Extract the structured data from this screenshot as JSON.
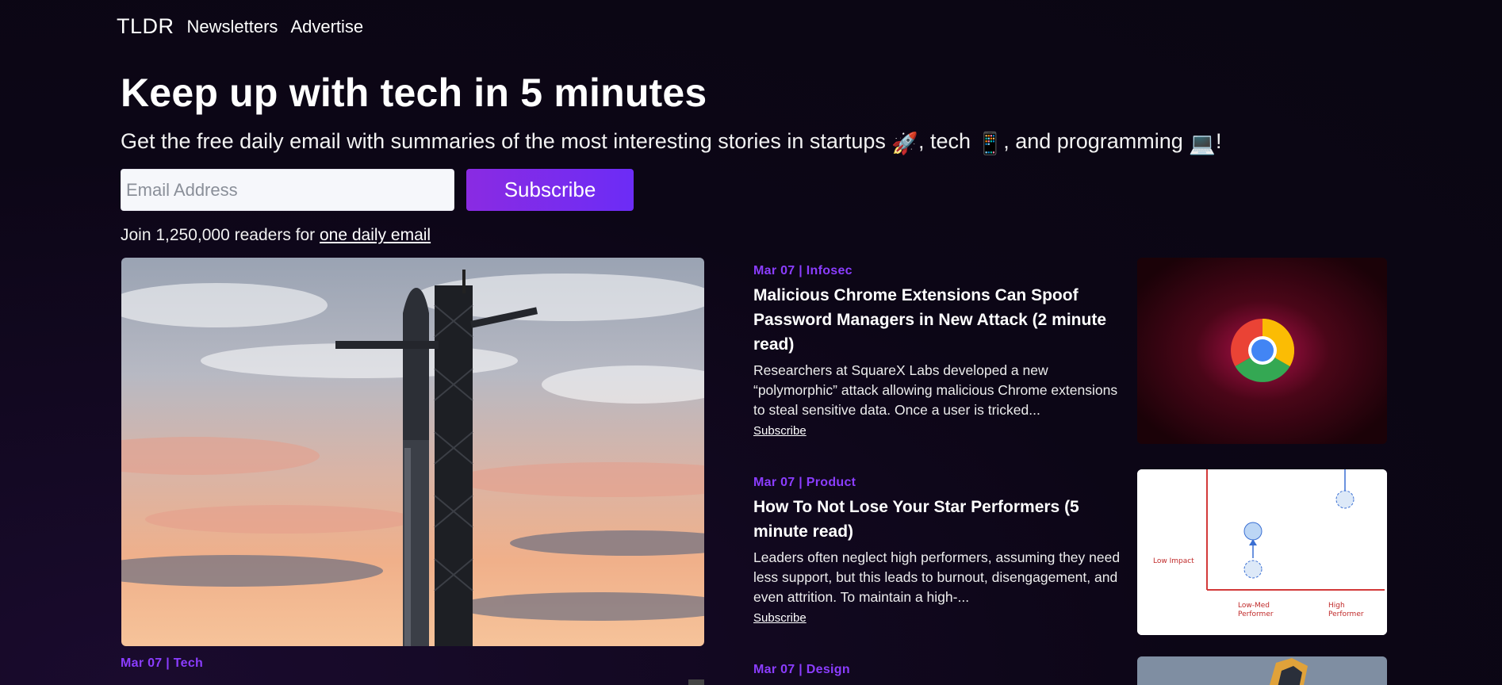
{
  "nav": {
    "brand": "TLDR",
    "links": [
      "Newsletters",
      "Advertise"
    ]
  },
  "hero": {
    "title": "Keep up with tech in 5 minutes",
    "subtitle_parts": [
      "Get the free daily email with summaries of the most interesting stories in startups ",
      "🚀",
      ", tech ",
      "📱",
      ", and programming ",
      "💻",
      "!"
    ],
    "email_placeholder": "Email Address",
    "subscribe_label": "Subscribe",
    "join_prefix": "Join 1,250,000 readers for ",
    "join_link": "one daily email"
  },
  "featured": {
    "meta": "Mar 07 | Tech",
    "image": "rocket-launch-tower-photo"
  },
  "articles": [
    {
      "meta": "Mar 07 | Infosec",
      "title": "Malicious Chrome Extensions Can Spoof Password Managers in New Attack (2 minute read)",
      "desc": "Researchers at SquareX Labs developed a new “polymorphic” attack allowing malicious Chrome extensions to steal sensitive data. Once a user is tricked...",
      "link": "Subscribe",
      "thumb": "chrome-logo"
    },
    {
      "meta": "Mar 07 | Product",
      "title": "How To Not Lose Your Star Performers (5 minute read)",
      "desc": "Leaders often neglect high performers, assuming they need less support, but this leads to burnout, disengagement, and even attrition. To maintain a high-...",
      "link": "Subscribe",
      "thumb": "impact-performer-chart",
      "thumb_labels": {
        "y": "Low Impact",
        "x1_line1": "Low-Med",
        "x1_line2": "Performer",
        "x2_line1": "High",
        "x2_line2": "Performer"
      }
    },
    {
      "meta": "Mar 07 | Design",
      "thumb": "design-photo"
    }
  ],
  "colors": {
    "accent": "#8b3dff",
    "background": "#0c0616",
    "button": "#7a2cf0"
  }
}
